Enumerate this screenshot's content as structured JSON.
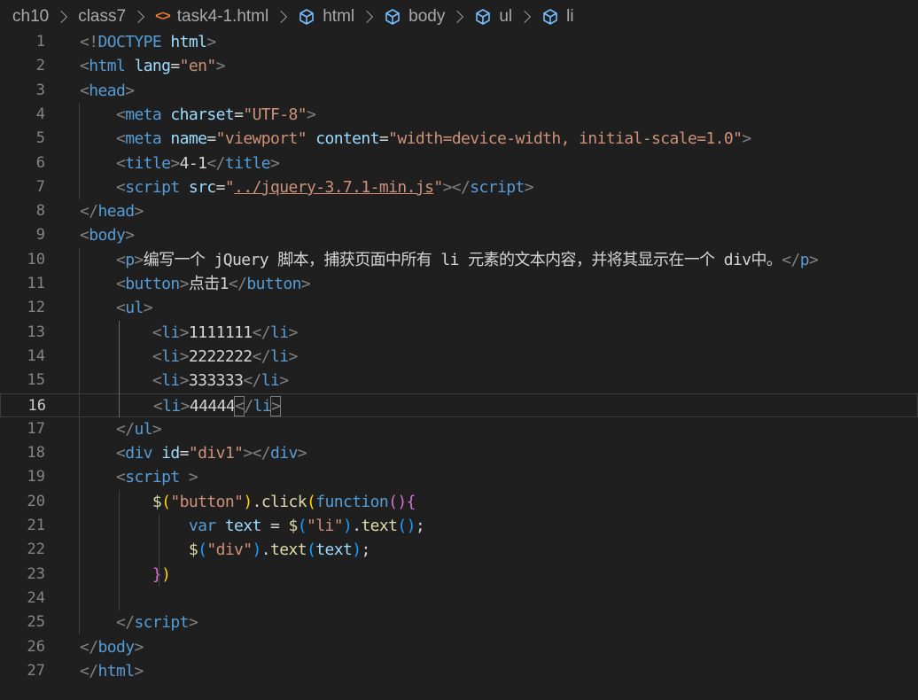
{
  "breadcrumb": {
    "folder1": "ch10",
    "folder2": "class7",
    "file": "task4-1.html",
    "path": [
      "html",
      "body",
      "ul",
      "li"
    ]
  },
  "editor": {
    "lines": [
      {
        "n": "1",
        "t": [
          [
            "tg",
            "<!"
          ],
          [
            "tn",
            "DOCTYPE"
          ],
          [
            "tx",
            " "
          ],
          [
            "at",
            "html"
          ],
          [
            "tg",
            ">"
          ]
        ]
      },
      {
        "n": "2",
        "t": [
          [
            "tg",
            "<"
          ],
          [
            "tn",
            "html"
          ],
          [
            "tx",
            " "
          ],
          [
            "at",
            "lang"
          ],
          [
            "tx",
            "="
          ],
          [
            "st",
            "\"en\""
          ],
          [
            "tg",
            ">"
          ]
        ]
      },
      {
        "n": "3",
        "t": [
          [
            "tg",
            "<"
          ],
          [
            "tn",
            "head"
          ],
          [
            "tg",
            ">"
          ]
        ]
      },
      {
        "n": "4",
        "t": [
          [
            "tx",
            "    "
          ],
          [
            "tg",
            "<"
          ],
          [
            "tn",
            "meta"
          ],
          [
            "tx",
            " "
          ],
          [
            "at",
            "charset"
          ],
          [
            "tx",
            "="
          ],
          [
            "st",
            "\"UTF-8\""
          ],
          [
            "tg",
            ">"
          ]
        ]
      },
      {
        "n": "5",
        "t": [
          [
            "tx",
            "    "
          ],
          [
            "tg",
            "<"
          ],
          [
            "tn",
            "meta"
          ],
          [
            "tx",
            " "
          ],
          [
            "at",
            "name"
          ],
          [
            "tx",
            "="
          ],
          [
            "st",
            "\"viewport\""
          ],
          [
            "tx",
            " "
          ],
          [
            "at",
            "content"
          ],
          [
            "tx",
            "="
          ],
          [
            "st",
            "\"width=device-width, initial-scale=1.0\""
          ],
          [
            "tg",
            ">"
          ]
        ]
      },
      {
        "n": "6",
        "t": [
          [
            "tx",
            "    "
          ],
          [
            "tg",
            "<"
          ],
          [
            "tn",
            "title"
          ],
          [
            "tg",
            ">"
          ],
          [
            "tx",
            "4-1"
          ],
          [
            "tg",
            "</"
          ],
          [
            "tn",
            "title"
          ],
          [
            "tg",
            ">"
          ]
        ]
      },
      {
        "n": "7",
        "t": [
          [
            "tx",
            "    "
          ],
          [
            "tg",
            "<"
          ],
          [
            "tn",
            "script"
          ],
          [
            "tx",
            " "
          ],
          [
            "at",
            "src"
          ],
          [
            "tx",
            "="
          ],
          [
            "st",
            "\""
          ],
          [
            "st ul",
            "../jquery-3.7.1-min.js"
          ],
          [
            "st",
            "\""
          ],
          [
            "tg",
            "></"
          ],
          [
            "tn",
            "script"
          ],
          [
            "tg",
            ">"
          ]
        ]
      },
      {
        "n": "8",
        "t": [
          [
            "tg",
            "</"
          ],
          [
            "tn",
            "head"
          ],
          [
            "tg",
            ">"
          ]
        ]
      },
      {
        "n": "9",
        "t": [
          [
            "tg",
            "<"
          ],
          [
            "tn",
            "body"
          ],
          [
            "tg",
            ">"
          ]
        ]
      },
      {
        "n": "10",
        "t": [
          [
            "tx",
            "    "
          ],
          [
            "tg",
            "<"
          ],
          [
            "tn",
            "p"
          ],
          [
            "tg",
            ">"
          ],
          [
            "tx",
            "编写一个 jQuery 脚本，捕获页面中所有 li 元素的文本内容，并将其显示在一个 div中。"
          ],
          [
            "tg",
            "</"
          ],
          [
            "tn",
            "p"
          ],
          [
            "tg",
            ">"
          ]
        ]
      },
      {
        "n": "11",
        "t": [
          [
            "tx",
            "    "
          ],
          [
            "tg",
            "<"
          ],
          [
            "tn",
            "button"
          ],
          [
            "tg",
            ">"
          ],
          [
            "tx",
            "点击1"
          ],
          [
            "tg",
            "</"
          ],
          [
            "tn",
            "button"
          ],
          [
            "tg",
            ">"
          ]
        ]
      },
      {
        "n": "12",
        "t": [
          [
            "tx",
            "    "
          ],
          [
            "tg",
            "<"
          ],
          [
            "tn",
            "ul"
          ],
          [
            "tg",
            ">"
          ]
        ]
      },
      {
        "n": "13",
        "t": [
          [
            "tx",
            "        "
          ],
          [
            "tg",
            "<"
          ],
          [
            "tn",
            "li"
          ],
          [
            "tg",
            ">"
          ],
          [
            "tx",
            "1111111"
          ],
          [
            "tg",
            "</"
          ],
          [
            "tn",
            "li"
          ],
          [
            "tg",
            ">"
          ]
        ]
      },
      {
        "n": "14",
        "t": [
          [
            "tx",
            "        "
          ],
          [
            "tg",
            "<"
          ],
          [
            "tn",
            "li"
          ],
          [
            "tg",
            ">"
          ],
          [
            "tx",
            "2222222"
          ],
          [
            "tg",
            "</"
          ],
          [
            "tn",
            "li"
          ],
          [
            "tg",
            ">"
          ]
        ]
      },
      {
        "n": "15",
        "t": [
          [
            "tx",
            "        "
          ],
          [
            "tg",
            "<"
          ],
          [
            "tn",
            "li"
          ],
          [
            "tg",
            ">"
          ],
          [
            "tx",
            "333333"
          ],
          [
            "tg",
            "</"
          ],
          [
            "tn",
            "li"
          ],
          [
            "tg",
            ">"
          ]
        ]
      },
      {
        "n": "16",
        "t": [
          [
            "tx",
            "        "
          ],
          [
            "tg",
            "<"
          ],
          [
            "tn",
            "li"
          ],
          [
            "tg",
            ">"
          ],
          [
            "tx",
            "44444"
          ],
          [
            "tg match",
            "<"
          ],
          [
            "tg",
            "/"
          ],
          [
            "tn",
            "li"
          ],
          [
            "tg match",
            ">"
          ]
        ]
      },
      {
        "n": "17",
        "t": [
          [
            "tx",
            "    "
          ],
          [
            "tg",
            "</"
          ],
          [
            "tn",
            "ul"
          ],
          [
            "tg",
            ">"
          ]
        ]
      },
      {
        "n": "18",
        "t": [
          [
            "tx",
            "    "
          ],
          [
            "tg",
            "<"
          ],
          [
            "tn",
            "div"
          ],
          [
            "tx",
            " "
          ],
          [
            "at",
            "id"
          ],
          [
            "tx",
            "="
          ],
          [
            "st",
            "\"div1\""
          ],
          [
            "tg",
            "></"
          ],
          [
            "tn",
            "div"
          ],
          [
            "tg",
            ">"
          ]
        ]
      },
      {
        "n": "19",
        "t": [
          [
            "tx",
            "    "
          ],
          [
            "tg",
            "<"
          ],
          [
            "tn",
            "script"
          ],
          [
            "tx",
            " "
          ],
          [
            "tg",
            ">"
          ]
        ]
      },
      {
        "n": "20",
        "t": [
          [
            "tx",
            "        "
          ],
          [
            "fn",
            "$"
          ],
          [
            "p1",
            "("
          ],
          [
            "st",
            "\"button\""
          ],
          [
            "p1",
            ")"
          ],
          [
            "tx",
            "."
          ],
          [
            "fn",
            "click"
          ],
          [
            "p1",
            "("
          ],
          [
            "kw",
            "function"
          ],
          [
            "p2",
            "()"
          ],
          [
            "p2",
            "{"
          ]
        ]
      },
      {
        "n": "21",
        "t": [
          [
            "tx",
            "            "
          ],
          [
            "kw",
            "var"
          ],
          [
            "tx",
            " "
          ],
          [
            "vr",
            "text"
          ],
          [
            "tx",
            " = "
          ],
          [
            "fn",
            "$"
          ],
          [
            "p3",
            "("
          ],
          [
            "st",
            "\"li\""
          ],
          [
            "p3",
            ")"
          ],
          [
            "tx",
            "."
          ],
          [
            "fn",
            "text"
          ],
          [
            "p3",
            "()"
          ],
          [
            "tx",
            ";"
          ]
        ]
      },
      {
        "n": "22",
        "t": [
          [
            "tx",
            "            "
          ],
          [
            "fn",
            "$"
          ],
          [
            "p3",
            "("
          ],
          [
            "st",
            "\"div\""
          ],
          [
            "p3",
            ")"
          ],
          [
            "tx",
            "."
          ],
          [
            "fn",
            "text"
          ],
          [
            "p3",
            "("
          ],
          [
            "vr",
            "text"
          ],
          [
            "p3",
            ")"
          ],
          [
            "tx",
            ";"
          ]
        ]
      },
      {
        "n": "23",
        "t": [
          [
            "tx",
            "        "
          ],
          [
            "p2",
            "}"
          ],
          [
            "p1",
            ")"
          ]
        ]
      },
      {
        "n": "24",
        "t": []
      },
      {
        "n": "25",
        "t": [
          [
            "tx",
            "    "
          ],
          [
            "tg",
            "</"
          ],
          [
            "tn",
            "script"
          ],
          [
            "tg",
            ">"
          ]
        ]
      },
      {
        "n": "26",
        "t": [
          [
            "tg",
            "</"
          ],
          [
            "tn",
            "body"
          ],
          [
            "tg",
            ">"
          ]
        ]
      },
      {
        "n": "27",
        "t": [
          [
            "tg",
            "</"
          ],
          [
            "tn",
            "html"
          ],
          [
            "tg",
            ">"
          ]
        ]
      }
    ]
  },
  "icons": {
    "file_icon": "html-code-icon",
    "symbol_icon": "cube-icon"
  },
  "colors": {
    "background": "#1f1f1f",
    "tag": "#569cd6",
    "attribute": "#9cdcfe",
    "string": "#ce9178",
    "function": "#dcdcaa",
    "text": "#d4d4d4",
    "line_number": "#858585"
  }
}
